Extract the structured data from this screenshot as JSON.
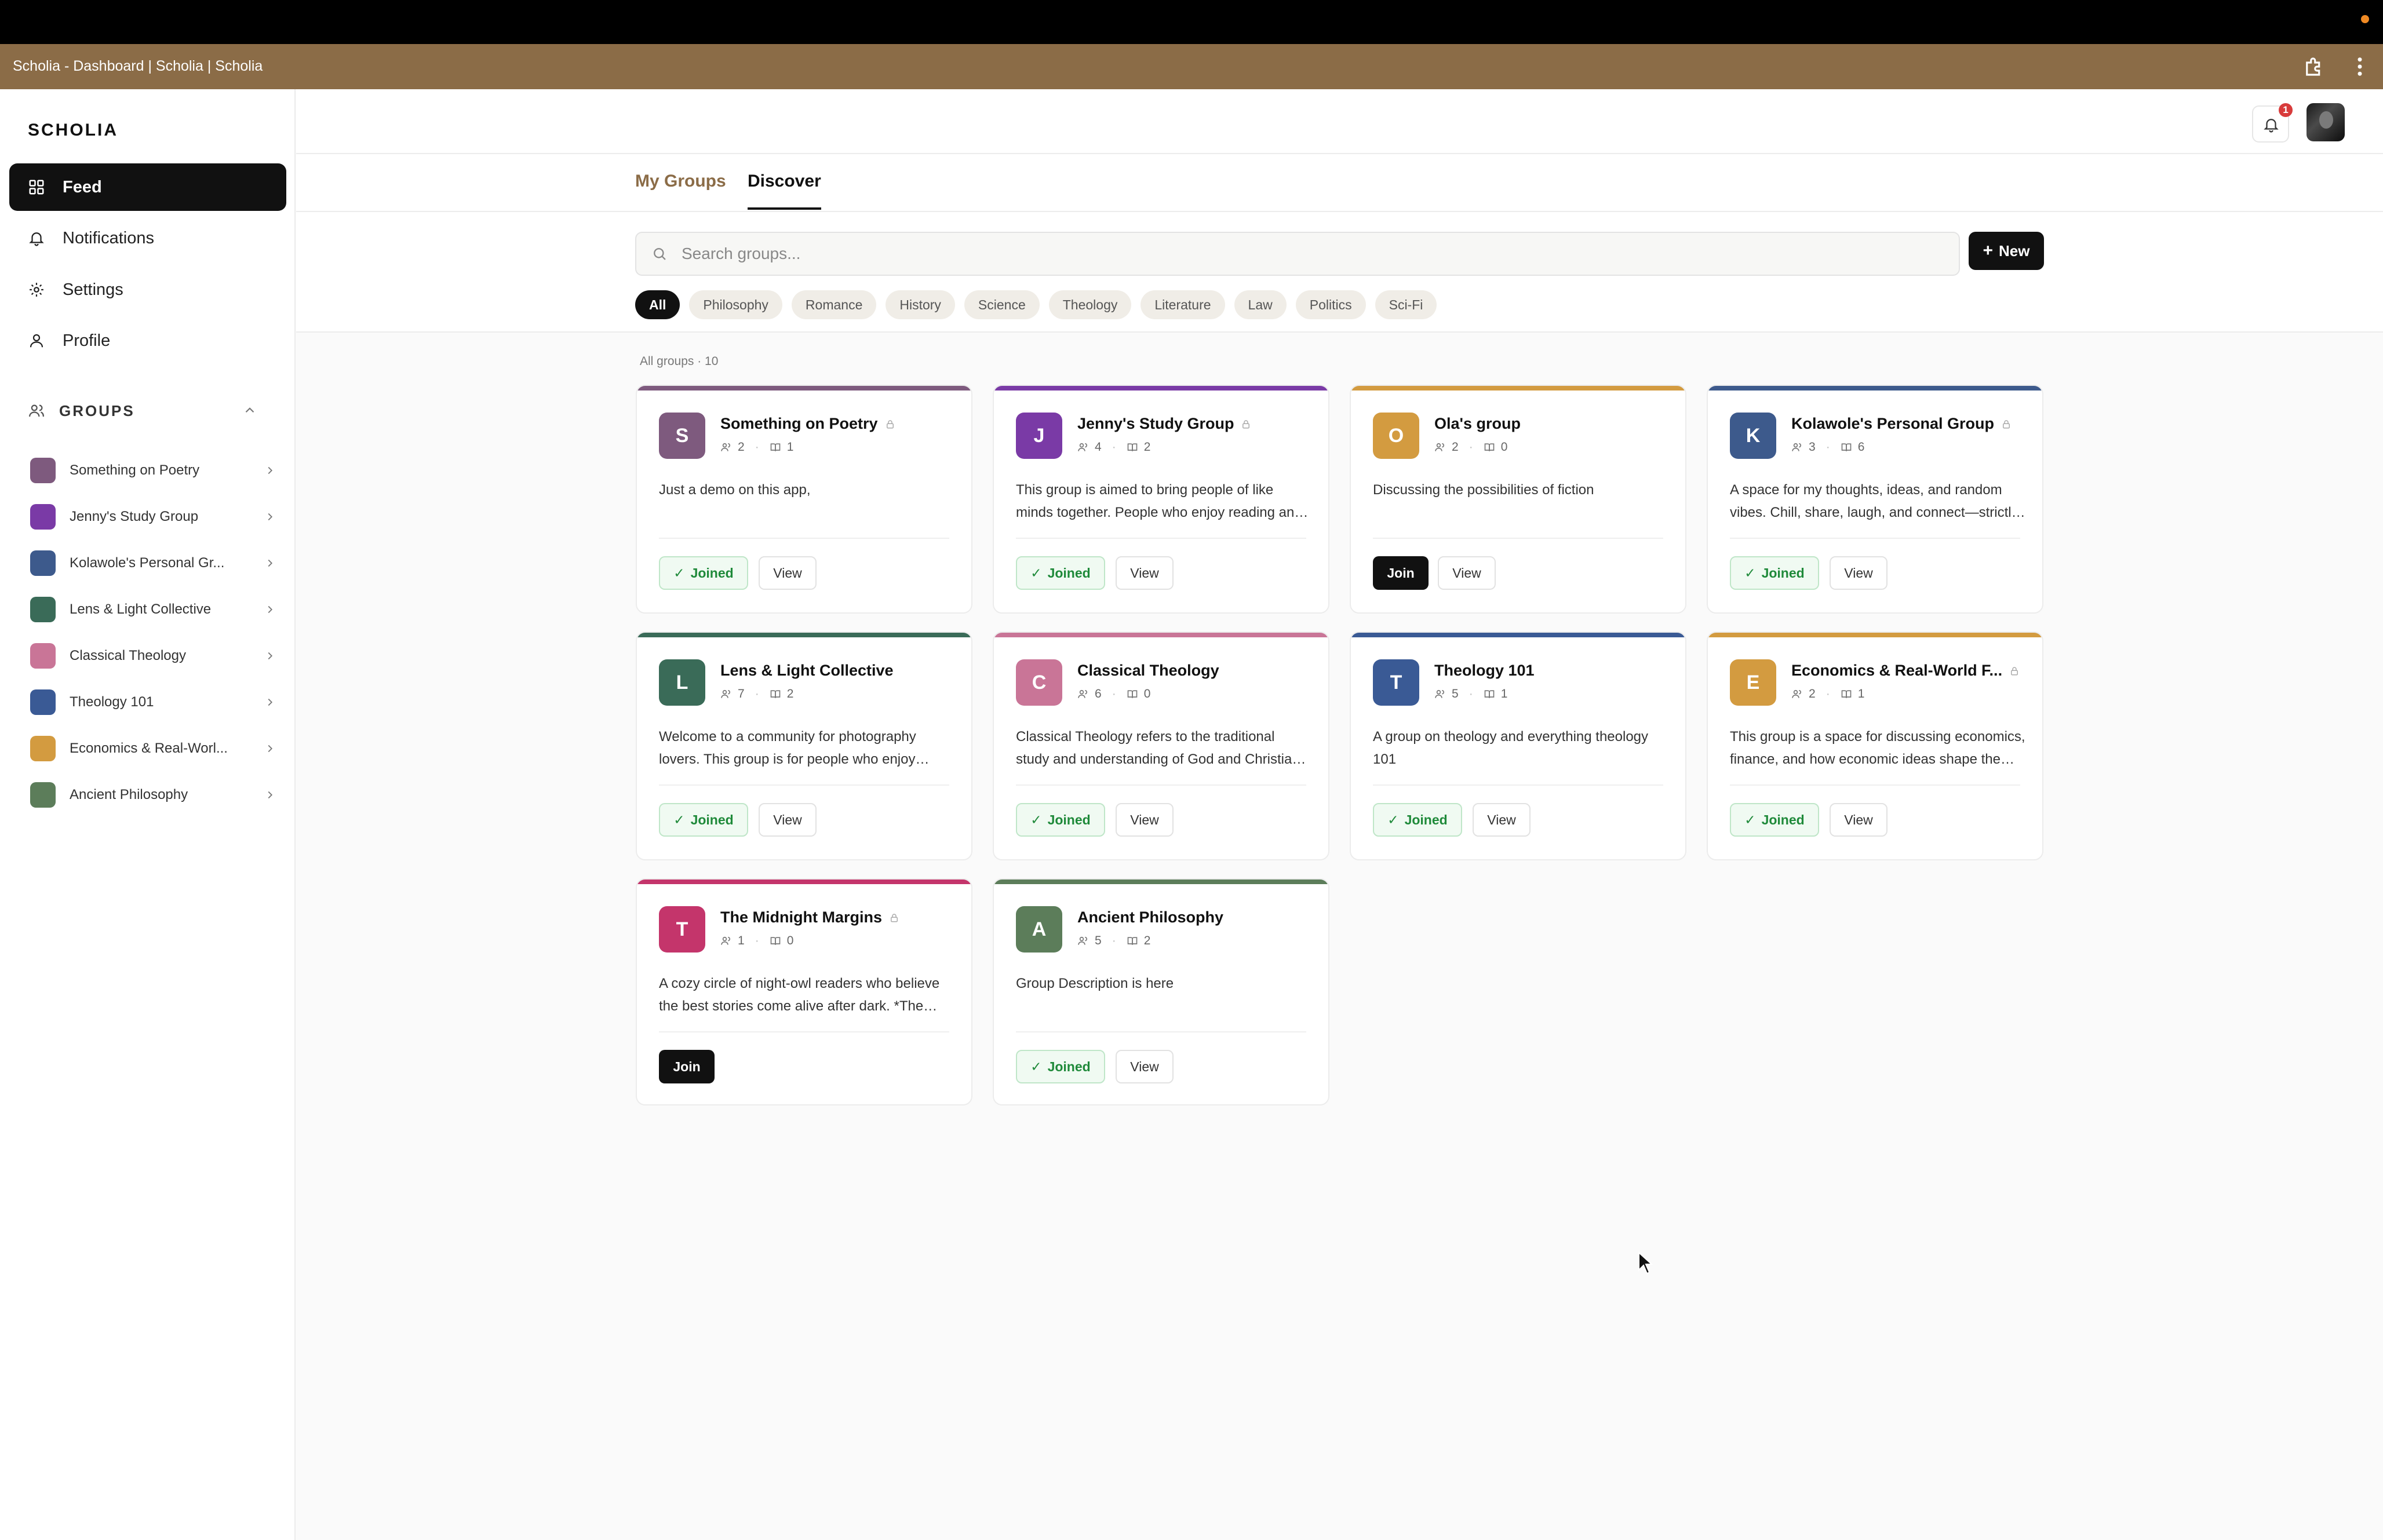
{
  "window": {
    "title": "Scholia - Dashboard | Scholia | Scholia"
  },
  "sidebar": {
    "brand": "SCHOLIA",
    "nav": [
      {
        "label": "Feed",
        "icon": "grid-icon",
        "active": true
      },
      {
        "label": "Notifications",
        "icon": "bell-icon"
      },
      {
        "label": "Settings",
        "icon": "gear-icon"
      },
      {
        "label": "Profile",
        "icon": "user-icon"
      }
    ],
    "groups_heading": "GROUPS",
    "groups": [
      {
        "label": "Something on Poetry",
        "color": "#7e5a7e"
      },
      {
        "label": "Jenny's Study Group",
        "color": "#7a3aa6"
      },
      {
        "label": "Kolawole's Personal Gr...",
        "color": "#3d5a8c"
      },
      {
        "label": "Lens & Light Collective",
        "color": "#3a6b58"
      },
      {
        "label": "Classical Theology",
        "color": "#c97597"
      },
      {
        "label": "Theology 101",
        "color": "#3a5a95"
      },
      {
        "label": "Economics & Real-Worl...",
        "color": "#d39b40"
      },
      {
        "label": "Ancient Philosophy",
        "color": "#5c7d5a"
      }
    ]
  },
  "header": {
    "notification_count": "1"
  },
  "tabs": [
    {
      "label": "My Groups",
      "active": false
    },
    {
      "label": "Discover",
      "active": true
    }
  ],
  "search": {
    "placeholder": "Search groups..."
  },
  "new_button": {
    "label": "New"
  },
  "filters": [
    "All",
    "Philosophy",
    "Romance",
    "History",
    "Science",
    "Theology",
    "Literature",
    "Law",
    "Politics",
    "Sci-Fi"
  ],
  "groups_count": "All groups · 10",
  "cards": [
    {
      "initial": "S",
      "name": "Something on Poetry",
      "locked": true,
      "members": "2",
      "posts": "1",
      "description": "Just a demo on this app,",
      "status": "Joined",
      "color": "#7e5a7e",
      "bar": "#7e5a7e"
    },
    {
      "initial": "J",
      "name": "Jenny's Study Group",
      "locked": true,
      "members": "4",
      "posts": "2",
      "description": "This group is aimed to bring people of like minds together. People who enjoy reading and learning together.",
      "status": "Joined",
      "color": "#7a3aa6",
      "bar": "#7a3aa6"
    },
    {
      "initial": "O",
      "name": "Ola's group",
      "locked": false,
      "members": "2",
      "posts": "0",
      "description": "Discussing the possibilities of fiction",
      "status": "Join",
      "color": "#d39b40",
      "bar": "#d39b40"
    },
    {
      "initial": "K",
      "name": "Kolawole's Personal Group",
      "locked": true,
      "members": "3",
      "posts": "6",
      "description": "A space for my thoughts, ideas, and random vibes. Chill, share, laugh, and connect—strictly good energy.",
      "status": "Joined",
      "color": "#3d5a8c",
      "bar": "#3d5a8c"
    },
    {
      "initial": "L",
      "name": "Lens & Light Collective",
      "locked": false,
      "members": "7",
      "posts": "2",
      "description": "Welcome to a community for photography lovers. This group is for people who enjoy capturing moments.",
      "status": "Joined",
      "color": "#3a6b58",
      "bar": "#3a6b58"
    },
    {
      "initial": "C",
      "name": "Classical Theology",
      "locked": false,
      "members": "6",
      "posts": "0",
      "description": "Classical Theology refers to the traditional study and understanding of God and Christian doctrine.",
      "status": "Joined",
      "color": "#c97597",
      "bar": "#c97597"
    },
    {
      "initial": "T",
      "name": "Theology 101",
      "locked": false,
      "members": "5",
      "posts": "1",
      "description": "A group on theology and everything theology 101",
      "status": "Joined",
      "color": "#3a5a95",
      "bar": "#3a5a95"
    },
    {
      "initial": "E",
      "name": "Economics & Real-World F...",
      "locked": true,
      "members": "2",
      "posts": "1",
      "description": "This group is a space for discussing economics, finance, and how economic ideas shape the real world.",
      "status": "Joined",
      "color": "#d39b40",
      "bar": "#d39b40"
    },
    {
      "initial": "T",
      "name": "The Midnight Margins",
      "locked": true,
      "members": "1",
      "posts": "0",
      "description": "A cozy circle of night-owl readers who believe the best stories come alive after dark. *The Midnight Margins*",
      "status": "Join",
      "color": "#c4356b",
      "bar": "#c4356b",
      "hide_view": true
    },
    {
      "initial": "A",
      "name": "Ancient Philosophy",
      "locked": false,
      "members": "5",
      "posts": "2",
      "description": "Group Description is here",
      "status": "Joined",
      "color": "#5c7d5a",
      "bar": "#5c7d5a"
    }
  ],
  "labels": {
    "joined": "Joined",
    "join": "Join",
    "view": "View"
  }
}
